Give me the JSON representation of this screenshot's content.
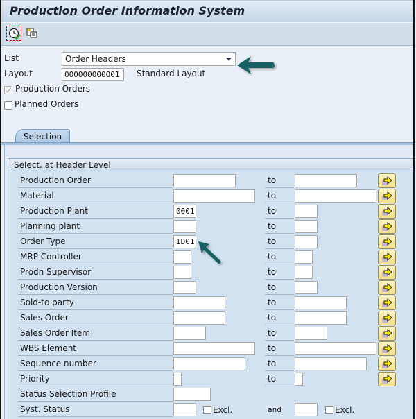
{
  "window": {
    "title": "Production Order Information System"
  },
  "toolbar": {
    "buttons": [
      {
        "name": "execute",
        "icon": "clock-check-icon"
      },
      {
        "name": "get-variant",
        "icon": "copy-variant-icon"
      }
    ]
  },
  "header": {
    "list_label": "List",
    "list_value": "Order Headers",
    "layout_label": "Layout",
    "layout_value": "000000000001",
    "layout_desc": "Standard Layout",
    "production_orders": {
      "label": "Production Orders",
      "checked": true
    },
    "planned_orders": {
      "label": "Planned Orders",
      "checked": false
    }
  },
  "tabs": [
    {
      "label": "Selection",
      "active": true
    }
  ],
  "group": {
    "title": "Select. at Header Level",
    "to_label": "to",
    "and_label": "and",
    "excl_label": "Excl.",
    "rows": [
      {
        "label": "Production Order",
        "from": "",
        "to": ""
      },
      {
        "label": "Material",
        "from": "",
        "to": ""
      },
      {
        "label": "Production Plant",
        "from": "0001",
        "to": ""
      },
      {
        "label": "Planning plant",
        "from": "",
        "to": ""
      },
      {
        "label": "Order Type",
        "from": "ID01",
        "to": ""
      },
      {
        "label": "MRP Controller",
        "from": "",
        "to": ""
      },
      {
        "label": "Prodn Supervisor",
        "from": "",
        "to": ""
      },
      {
        "label": "Production Version",
        "from": "",
        "to": ""
      },
      {
        "label": "Sold-to party",
        "from": "",
        "to": ""
      },
      {
        "label": "Sales Order",
        "from": "",
        "to": ""
      },
      {
        "label": "Sales Order Item",
        "from": "",
        "to": ""
      },
      {
        "label": "WBS Element",
        "from": "",
        "to": ""
      },
      {
        "label": "Sequence number",
        "from": "",
        "to": ""
      },
      {
        "label": "Priority",
        "from": "",
        "to": ""
      },
      {
        "label": "Status Selection Profile",
        "from": ""
      },
      {
        "label": "Syst. Status",
        "from": "",
        "to": "",
        "excl1": false,
        "excl2": false
      }
    ]
  },
  "colors": {
    "annotation_arrow": "#135f63",
    "multiple_selection_button": "#f6e79a"
  }
}
